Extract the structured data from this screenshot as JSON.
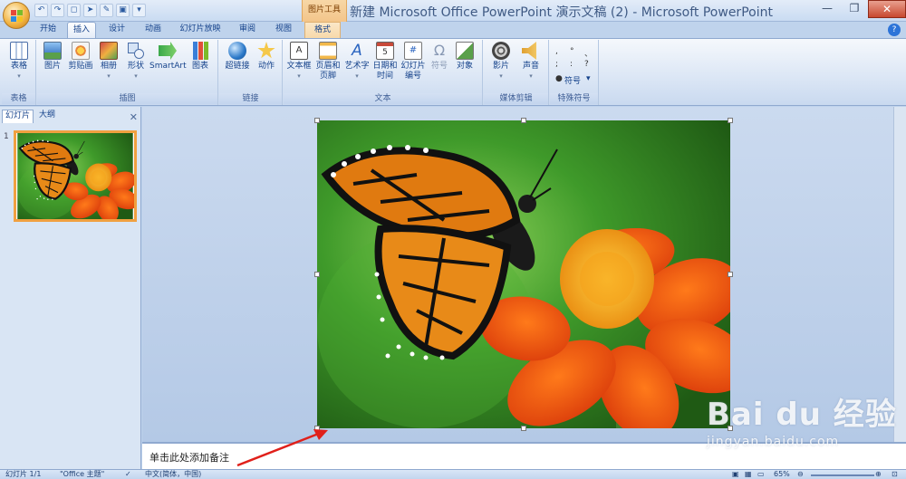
{
  "title_bar": {
    "context_tool": "图片工具",
    "window_title": "新建 Microsoft Office PowerPoint 演示文稿 (2) - Microsoft PowerPoint",
    "quick_access": [
      "undo-icon",
      "redo-icon",
      "save-icon"
    ]
  },
  "tabs": [
    {
      "label": "开始"
    },
    {
      "label": "插入"
    },
    {
      "label": "设计"
    },
    {
      "label": "动画"
    },
    {
      "label": "幻灯片放映"
    },
    {
      "label": "审阅"
    },
    {
      "label": "视图"
    },
    {
      "label": "格式"
    }
  ],
  "active_tab": "插入",
  "ribbon": {
    "groups": {
      "table": "表格",
      "illustrations": "插图",
      "links": "链接",
      "text": "文本",
      "media": "媒体剪辑",
      "special_symbols": "特殊符号"
    },
    "buttons": {
      "table": "表格",
      "picture": "图片",
      "clip_art": "剪贴画",
      "album": "相册",
      "shapes": "形状",
      "smartart": "SmartArt",
      "chart": "图表",
      "hyperlink": "超链接",
      "action": "动作",
      "textbox": "文本框",
      "header_footer_1": "页眉和",
      "header_footer_2": "页脚",
      "wordart": "艺术字",
      "datetime_1": "日期和",
      "datetime_2": "时间",
      "slide_number_1": "幻灯片",
      "slide_number_2": "编号",
      "symbol": "符号",
      "object": "对象",
      "movie": "影片",
      "sound": "声音",
      "special_symbol": "符号"
    }
  },
  "left_pane": {
    "tabs": [
      "幻灯片",
      "大纲"
    ],
    "slide_number": "1"
  },
  "notes_placeholder": "单击此处添加备注",
  "status_bar": {
    "slide_info": "幻灯片 1/1",
    "theme": "\"Office 主题\"",
    "language": "中文(简体，中国)",
    "zoom": "65%"
  },
  "watermark": {
    "brand": "Bai du 经验",
    "url": "jingyan.baidu.com"
  },
  "colors": {
    "accent_orange": "#f39b2e",
    "ribbon_blue": "#15428b",
    "frame_blue": "#bfd3ec"
  }
}
